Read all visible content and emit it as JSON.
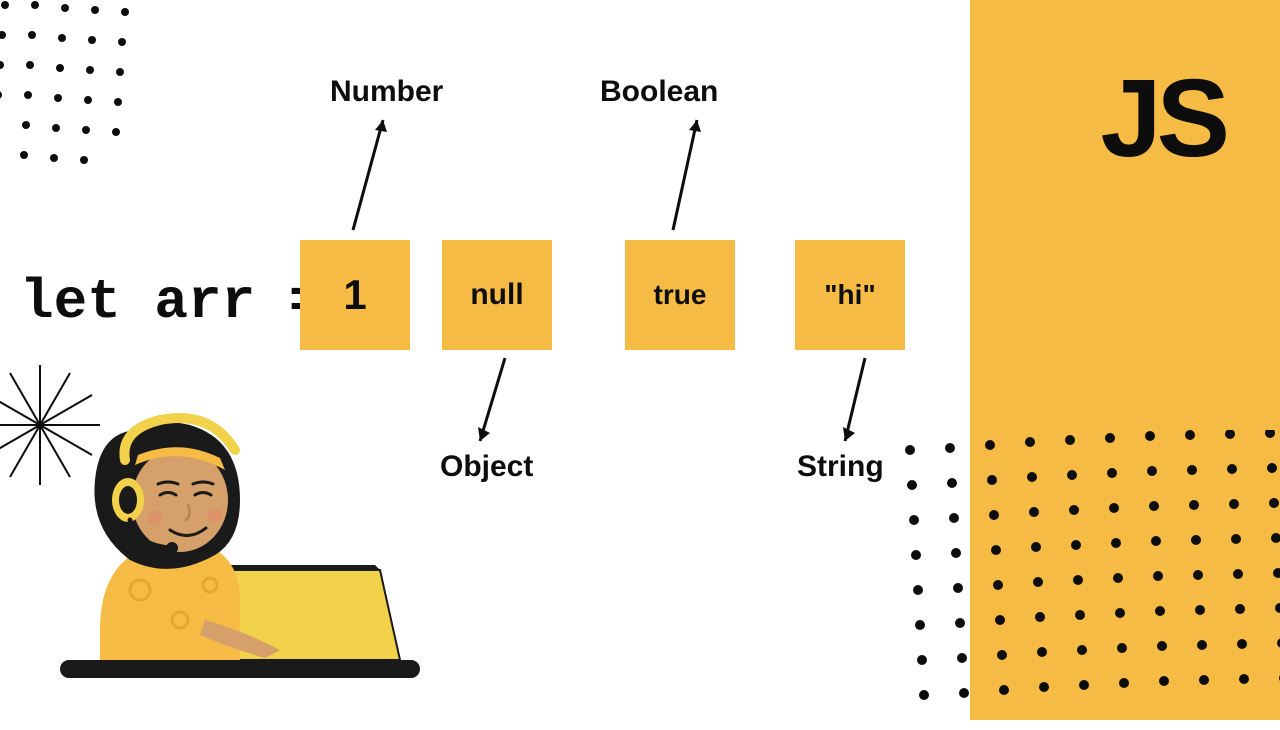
{
  "logo": "JS",
  "code": "let arr =",
  "boxes": [
    "1",
    "null",
    "true",
    "\"hi\""
  ],
  "labels": {
    "number": "Number",
    "boolean": "Boolean",
    "object": "Object",
    "string": "String"
  },
  "colors": {
    "accent": "#f6bb45",
    "text": "#0d0d0d"
  }
}
